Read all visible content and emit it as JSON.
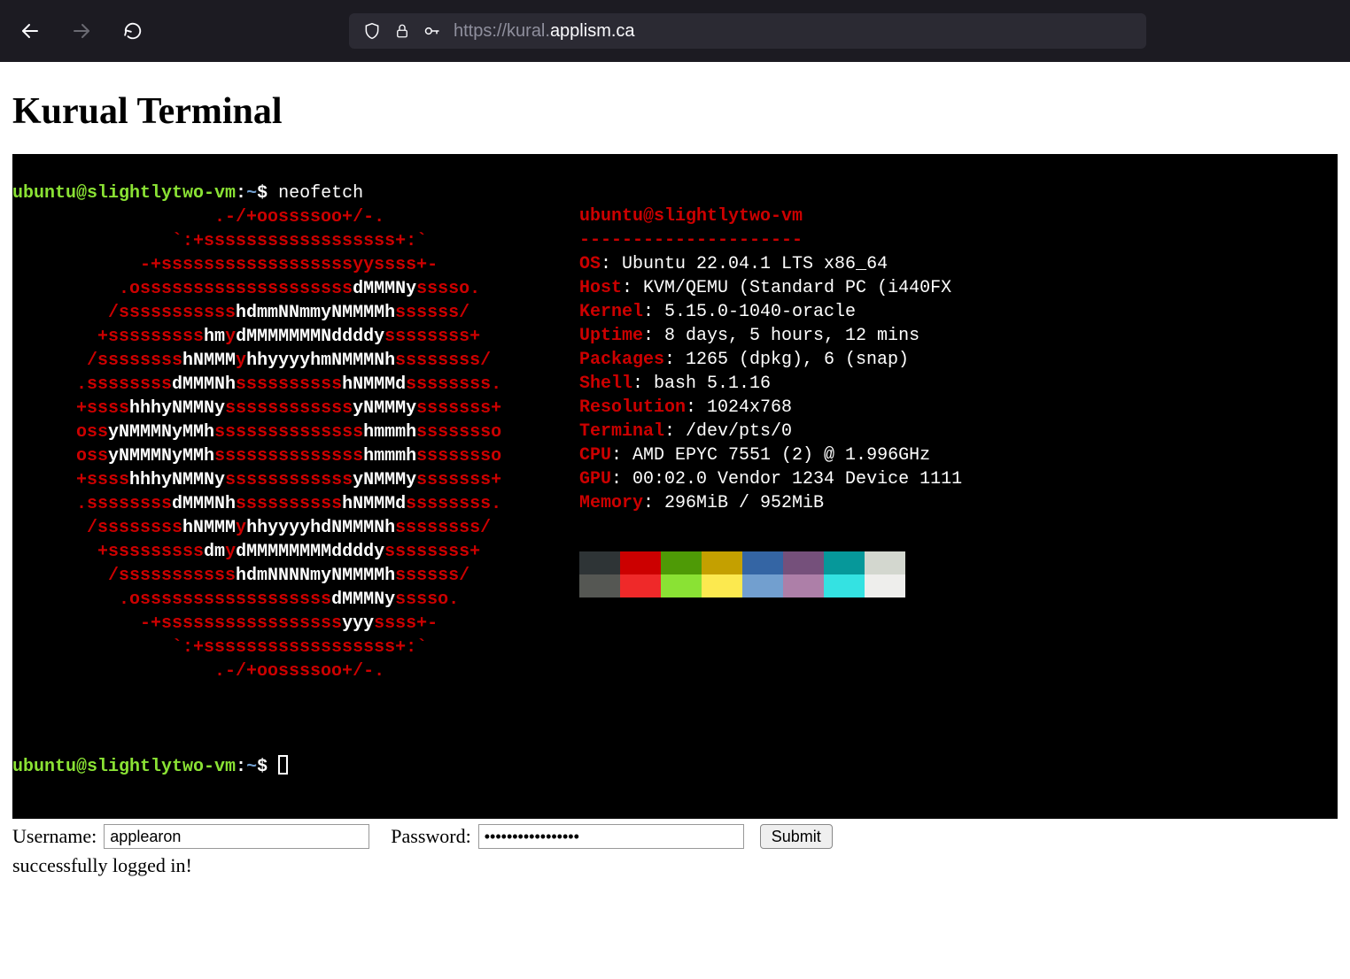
{
  "browser": {
    "url_prefix": "https://kural.",
    "url_highlight": "applism.ca"
  },
  "page": {
    "title": "Kurual Terminal"
  },
  "terminal": {
    "prompt_user_host": "ubuntu@slightlytwo-vm",
    "prompt_path": "~",
    "prompt_symbol": "$",
    "command": "neofetch",
    "logo_lines": [
      {
        "pad": "                   ",
        "segs": [
          {
            "c": "r",
            "t": ".-/+oossssoo+/-."
          }
        ]
      },
      {
        "pad": "               ",
        "segs": [
          {
            "c": "r",
            "t": "`:+ssssssssssssssssss+:`"
          }
        ]
      },
      {
        "pad": "            ",
        "segs": [
          {
            "c": "r",
            "t": "-+ssssssssssssssssssyyssss+-"
          }
        ]
      },
      {
        "pad": "          ",
        "segs": [
          {
            "c": "r",
            "t": ".ossssssssssssssssssss"
          },
          {
            "c": "w",
            "t": "dMMMNy"
          },
          {
            "c": "r",
            "t": "sssso."
          }
        ]
      },
      {
        "pad": "         ",
        "segs": [
          {
            "c": "r",
            "t": "/sssssssssss"
          },
          {
            "c": "w",
            "t": "hdmmNNmmyNMMMMh"
          },
          {
            "c": "r",
            "t": "ssssss/"
          }
        ]
      },
      {
        "pad": "        ",
        "segs": [
          {
            "c": "r",
            "t": "+sssssssss"
          },
          {
            "c": "w",
            "t": "hm"
          },
          {
            "c": "r",
            "t": "y"
          },
          {
            "c": "w",
            "t": "dMMMMMMMNddddy"
          },
          {
            "c": "r",
            "t": "ssssssss+"
          }
        ]
      },
      {
        "pad": "       ",
        "segs": [
          {
            "c": "r",
            "t": "/ssssssss"
          },
          {
            "c": "w",
            "t": "hNMMM"
          },
          {
            "c": "r",
            "t": "y"
          },
          {
            "c": "w",
            "t": "hhyyyyhmNMMMNh"
          },
          {
            "c": "r",
            "t": "ssssssss/"
          }
        ]
      },
      {
        "pad": "      ",
        "segs": [
          {
            "c": "r",
            "t": ".ssssssss"
          },
          {
            "c": "w",
            "t": "dMMMNh"
          },
          {
            "c": "r",
            "t": "ssssssssss"
          },
          {
            "c": "w",
            "t": "hNMMMd"
          },
          {
            "c": "r",
            "t": "ssssssss."
          }
        ]
      },
      {
        "pad": "      ",
        "segs": [
          {
            "c": "r",
            "t": "+ssss"
          },
          {
            "c": "w",
            "t": "hhhyNMMNy"
          },
          {
            "c": "r",
            "t": "ssssssssssss"
          },
          {
            "c": "w",
            "t": "yNMMMy"
          },
          {
            "c": "r",
            "t": "sssssss+"
          }
        ]
      },
      {
        "pad": "      ",
        "segs": [
          {
            "c": "r",
            "t": "oss"
          },
          {
            "c": "w",
            "t": "yNMMMNyMMh"
          },
          {
            "c": "r",
            "t": "ssssssssssssss"
          },
          {
            "c": "w",
            "t": "hmmmh"
          },
          {
            "c": "r",
            "t": "ssssssso"
          }
        ]
      },
      {
        "pad": "      ",
        "segs": [
          {
            "c": "r",
            "t": "oss"
          },
          {
            "c": "w",
            "t": "yNMMMNyMMh"
          },
          {
            "c": "r",
            "t": "ssssssssssssss"
          },
          {
            "c": "w",
            "t": "hmmmh"
          },
          {
            "c": "r",
            "t": "ssssssso"
          }
        ]
      },
      {
        "pad": "      ",
        "segs": [
          {
            "c": "r",
            "t": "+ssss"
          },
          {
            "c": "w",
            "t": "hhhyNMMNy"
          },
          {
            "c": "r",
            "t": "ssssssssssss"
          },
          {
            "c": "w",
            "t": "yNMMMy"
          },
          {
            "c": "r",
            "t": "sssssss+"
          }
        ]
      },
      {
        "pad": "      ",
        "segs": [
          {
            "c": "r",
            "t": ".ssssssss"
          },
          {
            "c": "w",
            "t": "dMMMNh"
          },
          {
            "c": "r",
            "t": "ssssssssss"
          },
          {
            "c": "w",
            "t": "hNMMMd"
          },
          {
            "c": "r",
            "t": "ssssssss."
          }
        ]
      },
      {
        "pad": "       ",
        "segs": [
          {
            "c": "r",
            "t": "/ssssssss"
          },
          {
            "c": "w",
            "t": "hNMMM"
          },
          {
            "c": "r",
            "t": "y"
          },
          {
            "c": "w",
            "t": "hhyyyyhdNMMMNh"
          },
          {
            "c": "r",
            "t": "ssssssss/"
          }
        ]
      },
      {
        "pad": "        ",
        "segs": [
          {
            "c": "r",
            "t": "+sssssssss"
          },
          {
            "c": "w",
            "t": "dm"
          },
          {
            "c": "r",
            "t": "y"
          },
          {
            "c": "w",
            "t": "dMMMMMMMMddddy"
          },
          {
            "c": "r",
            "t": "ssssssss+"
          }
        ]
      },
      {
        "pad": "         ",
        "segs": [
          {
            "c": "r",
            "t": "/sssssssssss"
          },
          {
            "c": "w",
            "t": "hdmNNNNmyNMMMMh"
          },
          {
            "c": "r",
            "t": "ssssss/"
          }
        ]
      },
      {
        "pad": "          ",
        "segs": [
          {
            "c": "r",
            "t": ".ossssssssssssssssss"
          },
          {
            "c": "w",
            "t": "dMMMNy"
          },
          {
            "c": "r",
            "t": "sssso."
          }
        ]
      },
      {
        "pad": "            ",
        "segs": [
          {
            "c": "r",
            "t": "-+sssssssssssssssss"
          },
          {
            "c": "w",
            "t": "yyy"
          },
          {
            "c": "r",
            "t": "ssss+-"
          }
        ]
      },
      {
        "pad": "               ",
        "segs": [
          {
            "c": "r",
            "t": "`:+ssssssssssssssssss+:`"
          }
        ]
      },
      {
        "pad": "                   ",
        "segs": [
          {
            "c": "r",
            "t": ".-/+oossssoo+/-."
          }
        ]
      }
    ],
    "info_title": "ubuntu@slightlytwo-vm",
    "info_rule": "---------------------",
    "info_lines": [
      {
        "k": "OS",
        "v": ": Ubuntu 22.04.1 LTS x86_64"
      },
      {
        "k": "Host",
        "v": ": KVM/QEMU (Standard PC (i440FX"
      },
      {
        "k": "Kernel",
        "v": ": 5.15.0-1040-oracle"
      },
      {
        "k": "Uptime",
        "v": ": 8 days, 5 hours, 12 mins"
      },
      {
        "k": "Packages",
        "v": ": 1265 (dpkg), 6 (snap)"
      },
      {
        "k": "Shell",
        "v": ": bash 5.1.16"
      },
      {
        "k": "Resolution",
        "v": ": 1024x768"
      },
      {
        "k": "Terminal",
        "v": ": /dev/pts/0"
      },
      {
        "k": "CPU",
        "v": ": AMD EPYC 7551 (2) @ 1.996GHz"
      },
      {
        "k": "GPU",
        "v": ": 00:02.0 Vendor 1234 Device 1111"
      },
      {
        "k": "Memory",
        "v": ": 296MiB / 952MiB"
      }
    ],
    "swatches_row1": [
      "#2e3436",
      "#cc0000",
      "#4e9a06",
      "#c4a000",
      "#3465a4",
      "#75507b",
      "#06989a",
      "#d3d7cf"
    ],
    "swatches_row2": [
      "#555753",
      "#ef2929",
      "#8ae234",
      "#fce94f",
      "#729fcf",
      "#ad7fa8",
      "#34e2e2",
      "#eeeeec"
    ]
  },
  "form": {
    "username_label": "Username:",
    "password_label": "Password:",
    "username_value": "applearon",
    "password_value": "•••••••••••••••••",
    "submit_label": "Submit",
    "status": "successfully logged in!"
  }
}
